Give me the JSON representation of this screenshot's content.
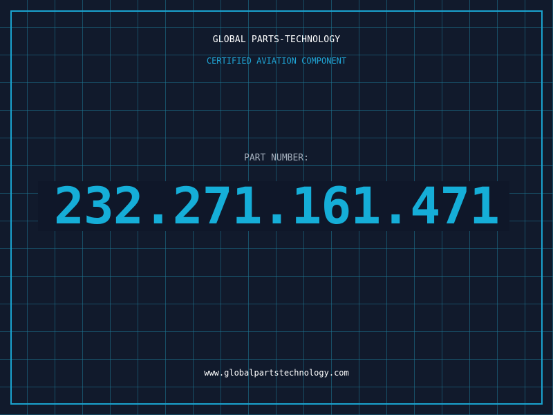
{
  "header": {
    "company": "GLOBAL PARTS-TECHNOLOGY",
    "tagline": "CERTIFIED AVIATION COMPONENT"
  },
  "part": {
    "label": "PART NUMBER:",
    "number": "232.271.161.471"
  },
  "footer": {
    "url": "www.globalpartstechnology.com"
  },
  "colors": {
    "background": "#111a2c",
    "grid": "#1e7896",
    "accent": "#1aa3cf",
    "number": "#15aed8",
    "label": "#a4afbd",
    "text": "#ffffff"
  }
}
